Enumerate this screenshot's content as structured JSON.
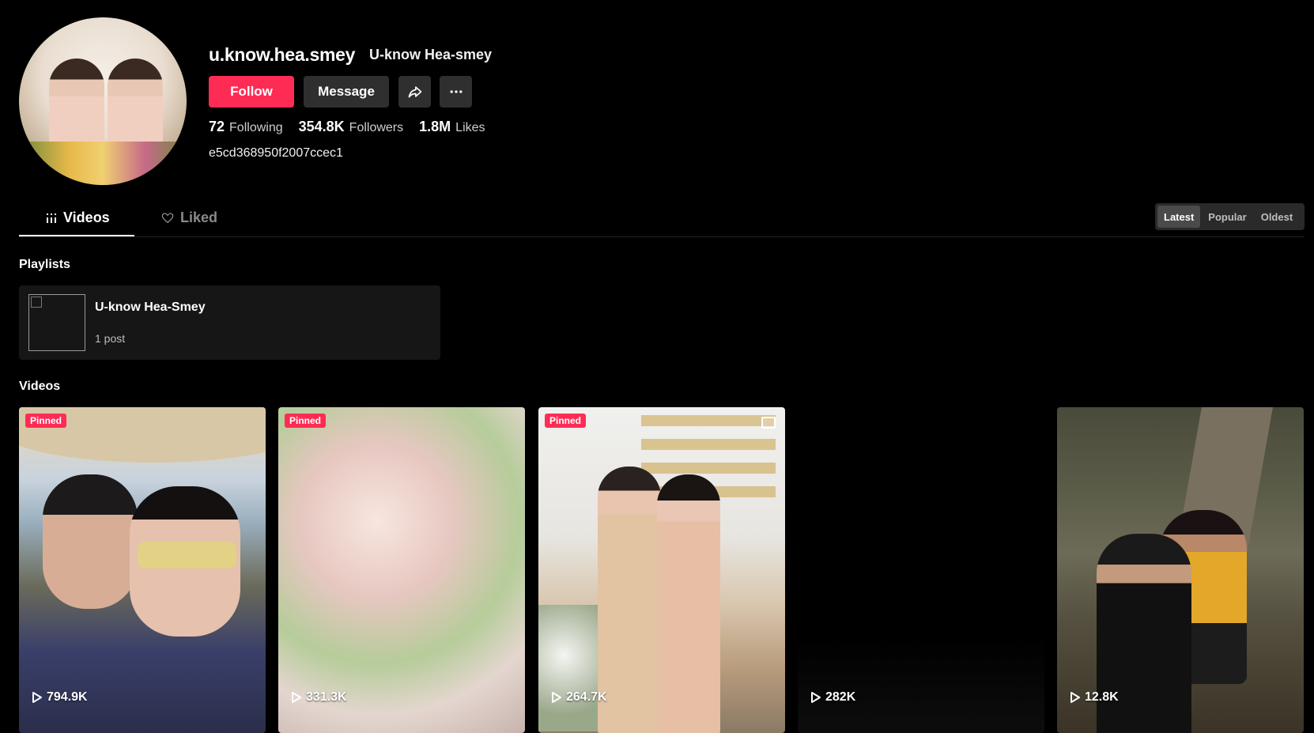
{
  "profile": {
    "username": "u.know.hea.smey",
    "nickname": "U-know Hea-smey",
    "bio": "e5cd368950f2007ccec1",
    "follow_label": "Follow",
    "message_label": "Message",
    "stats": {
      "following_count": "72",
      "following_label": "Following",
      "followers_count": "354.8K",
      "followers_label": "Followers",
      "likes_count": "1.8M",
      "likes_label": "Likes"
    }
  },
  "tabs": {
    "videos_label": "Videos",
    "liked_label": "Liked"
  },
  "sort": {
    "options": [
      "Latest",
      "Popular",
      "Oldest"
    ],
    "active": "Latest"
  },
  "playlists": {
    "section_title": "Playlists",
    "items": [
      {
        "name": "U-know Hea-Smey",
        "count": "1 post"
      }
    ]
  },
  "videos": {
    "section_title": "Videos",
    "items": [
      {
        "views": "794.9K",
        "pinned": "Pinned"
      },
      {
        "views": "331.3K",
        "pinned": "Pinned"
      },
      {
        "views": "264.7K",
        "pinned": "Pinned"
      },
      {
        "views": "282K"
      },
      {
        "views": "12.8K"
      }
    ]
  },
  "colors": {
    "accent": "#fe2c55",
    "background": "#000000",
    "button_secondary": "#2f2f2f"
  }
}
